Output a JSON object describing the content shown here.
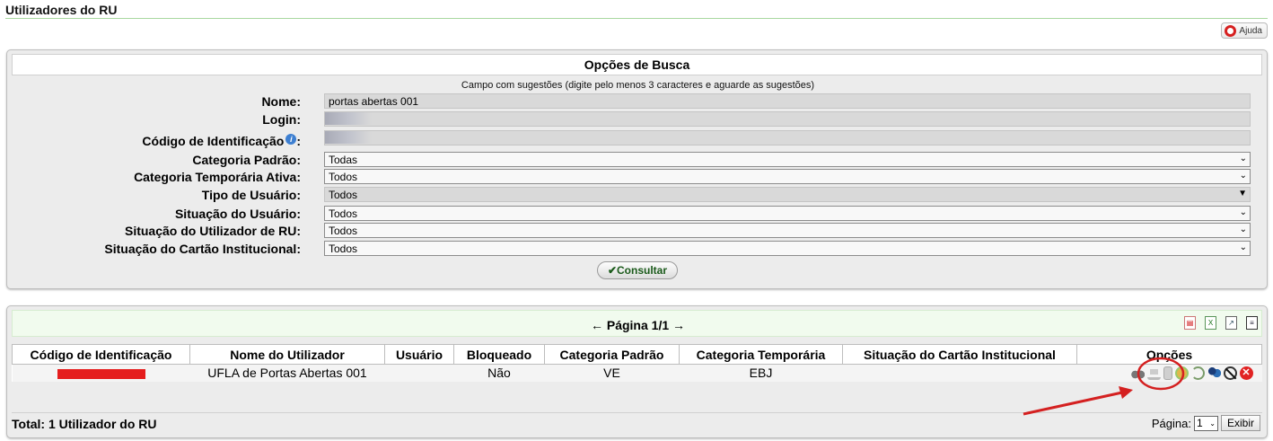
{
  "page": {
    "title": "Utilizadores do RU",
    "help_label": "Ajuda"
  },
  "search": {
    "caption": "Opções de Busca",
    "hint": "Campo com sugestões (digite pelo menos 3 caracteres e aguarde as sugestões)",
    "fields": {
      "nome": {
        "label": "Nome:",
        "value": "portas abertas 001"
      },
      "login": {
        "label": "Login:",
        "value": ""
      },
      "codigo": {
        "label": "Código de Identificação",
        "colon": ":",
        "value": ""
      },
      "categoria_padrao": {
        "label": "Categoria Padrão:",
        "value": "Todas"
      },
      "categoria_temporaria": {
        "label": "Categoria Temporária Ativa:",
        "value": "Todos"
      },
      "tipo_usuario": {
        "label": "Tipo de Usuário:",
        "value": "Todos"
      },
      "situacao_usuario": {
        "label": "Situação do Usuário:",
        "value": "Todos"
      },
      "situacao_utilizador": {
        "label": "Situação do Utilizador de RU:",
        "value": "Todos"
      },
      "situacao_cartao": {
        "label": "Situação do Cartão Institucional:",
        "value": "Todos"
      }
    },
    "submit_label": "Consultar",
    "submit_icon": "check-icon"
  },
  "results": {
    "pager": "← Página 1/1 →",
    "export_icons": [
      "pdf-icon",
      "excel-icon",
      "chart-icon",
      "document-icon"
    ],
    "columns": [
      "Código de Identificação",
      "Nome do Utilizador",
      "Usuário",
      "Bloqueado",
      "Categoria Padrão",
      "Categoria Temporária",
      "Situação do Cartão Institucional",
      "Opções"
    ],
    "rows": [
      {
        "codigo": "",
        "nome": "UFLA de Portas Abertas 001",
        "usuario": "",
        "bloqueado": "Não",
        "categoria_padrao": "VE",
        "categoria_temporaria": "EBJ",
        "situacao_cartao": ""
      }
    ],
    "option_icons": [
      "binoculars-icon",
      "cart-icon",
      "card-icon",
      "money-icon",
      "refresh-icon",
      "users-icon",
      "no-card-icon",
      "delete-icon"
    ],
    "total": "Total: 1 Utilizador do RU",
    "page_label": "Página:",
    "page_value": "1",
    "show_label": "Exibir"
  },
  "colors": {
    "redaction": "#e51d1d",
    "annotation": "#d42020",
    "header_rule": "#a8d8a0"
  }
}
